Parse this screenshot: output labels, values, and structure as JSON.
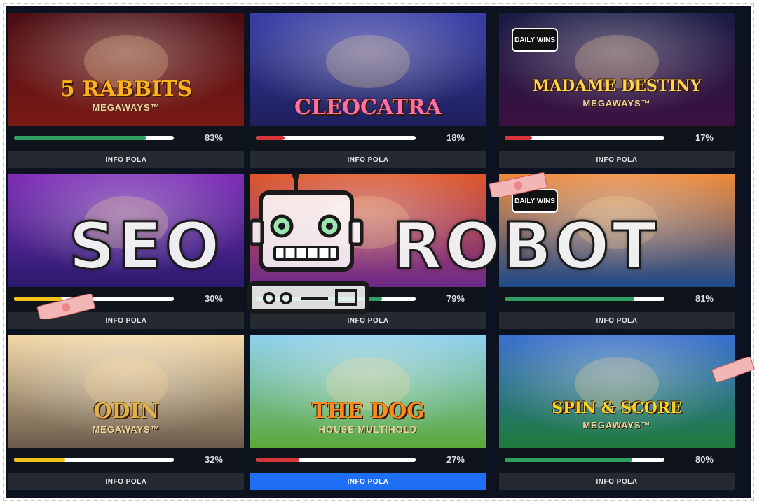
{
  "games": [
    {
      "title": "5 RABBITS",
      "subtitle": "MEGAWAYS™",
      "badge": "",
      "percent": 83,
      "percent_label": "83%",
      "bar_color": "#2e9e63",
      "button": "INFO POLA",
      "active": false,
      "bg_top": "#4a0d12",
      "bg_bottom": "#7a1a14",
      "title_color": "#ffb21e"
    },
    {
      "title": "CLEOCATRA",
      "subtitle": "",
      "badge": "",
      "percent": 18,
      "percent_label": "18%",
      "bar_color": "#d8353b",
      "button": "INFO POLA",
      "active": false,
      "bg_top": "#3a3fa8",
      "bg_bottom": "#1d1f5c",
      "title_color": "#ff6fae"
    },
    {
      "title": "MADAME DESTINY",
      "subtitle": "MEGAWAYS™",
      "badge": "DAILY WINS",
      "percent": 17,
      "percent_label": "17%",
      "bar_color": "#d8353b",
      "button": "INFO POLA",
      "active": false,
      "bg_top": "#1a1b44",
      "bg_bottom": "#3b1140",
      "title_color": "#ffd54a"
    },
    {
      "title": "",
      "subtitle": "",
      "badge": "",
      "percent": 30,
      "percent_label": "30%",
      "bar_color": "#f2c21a",
      "button": "INFO POLA",
      "active": false,
      "bg_top": "#7f2fb8",
      "bg_bottom": "#2a1a6e",
      "title_color": "#ffffff"
    },
    {
      "title": "",
      "subtitle": "",
      "badge": "",
      "percent": 79,
      "percent_label": "79%",
      "bar_color": "#2e9e63",
      "button": "INFO POLA",
      "active": false,
      "bg_top": "#e0582a",
      "bg_bottom": "#6b2a8a",
      "title_color": "#ffffff"
    },
    {
      "title": "",
      "subtitle": "",
      "badge": "DAILY WINS",
      "percent": 81,
      "percent_label": "81%",
      "bar_color": "#2e9e63",
      "button": "INFO POLA",
      "active": false,
      "bg_top": "#f08a3a",
      "bg_bottom": "#1f4a8a",
      "title_color": "#ffd54a"
    },
    {
      "title": "ODIN",
      "subtitle": "MEGAWAYS™",
      "badge": "",
      "percent": 32,
      "percent_label": "32%",
      "bar_color": "#f2c21a",
      "button": "INFO POLA",
      "active": false,
      "bg_top": "#f3d9a8",
      "bg_bottom": "#6a5a4a",
      "title_color": "#e0b24a"
    },
    {
      "title": "THE DOG",
      "subtitle": "HOUSE MULTIHOLD",
      "badge": "",
      "percent": 27,
      "percent_label": "27%",
      "bar_color": "#d8353b",
      "button": "INFO POLA",
      "active": true,
      "bg_top": "#8fd0f0",
      "bg_bottom": "#5aa83a",
      "title_color": "#ff8a1e"
    },
    {
      "title": "SPIN & SCORE",
      "subtitle": "MEGAWAYS™",
      "badge": "",
      "percent": 80,
      "percent_label": "80%",
      "bar_color": "#2e9e63",
      "button": "INFO POLA",
      "active": false,
      "bg_top": "#3a6fd0",
      "bg_bottom": "#1e7a3a",
      "title_color": "#ffd21e"
    }
  ],
  "watermark": {
    "left": "SEO",
    "right": "ROBOT",
    "icon": "robot-icon"
  }
}
